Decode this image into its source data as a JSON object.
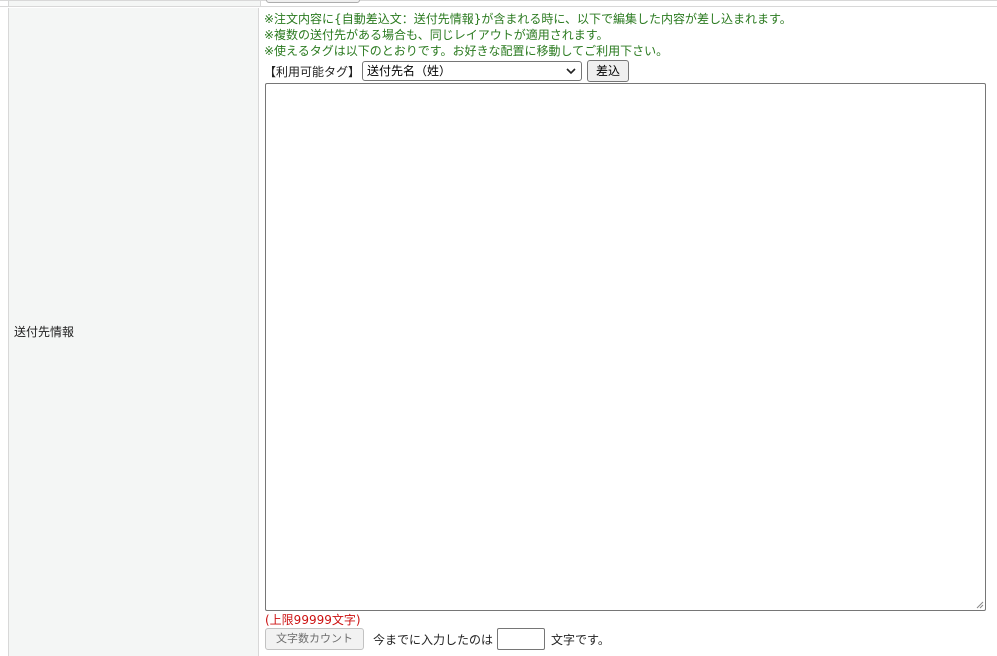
{
  "field": {
    "label": "送付先情報"
  },
  "notes": [
    "※注文内容に{自動差込文：送付先情報}が含まれる時に、以下で編集した内容が差し込まれます。",
    "※複数の送付先がある場合も、同じレイアウトが適用されます。",
    "※使えるタグは以下のとおりです。お好きな配置に移動してご利用下さい。"
  ],
  "tags": {
    "label": "【利用可能タグ】",
    "selected": "送付先名（姓）",
    "insert_label": "差込"
  },
  "editor": {
    "value": ""
  },
  "limit": {
    "text": "(上限99999文字)"
  },
  "counter": {
    "button_label": "文字数カウント",
    "prefix": "今までに入力したのは",
    "value": "",
    "suffix": "文字です。"
  },
  "colors": {
    "note_green": "#2a7a1f",
    "limit_red": "#cc1111",
    "label_bg": "#f4f6f5"
  },
  "icons": {
    "select_arrow": "chevron-down-icon",
    "resize": "resize-grip-icon"
  }
}
